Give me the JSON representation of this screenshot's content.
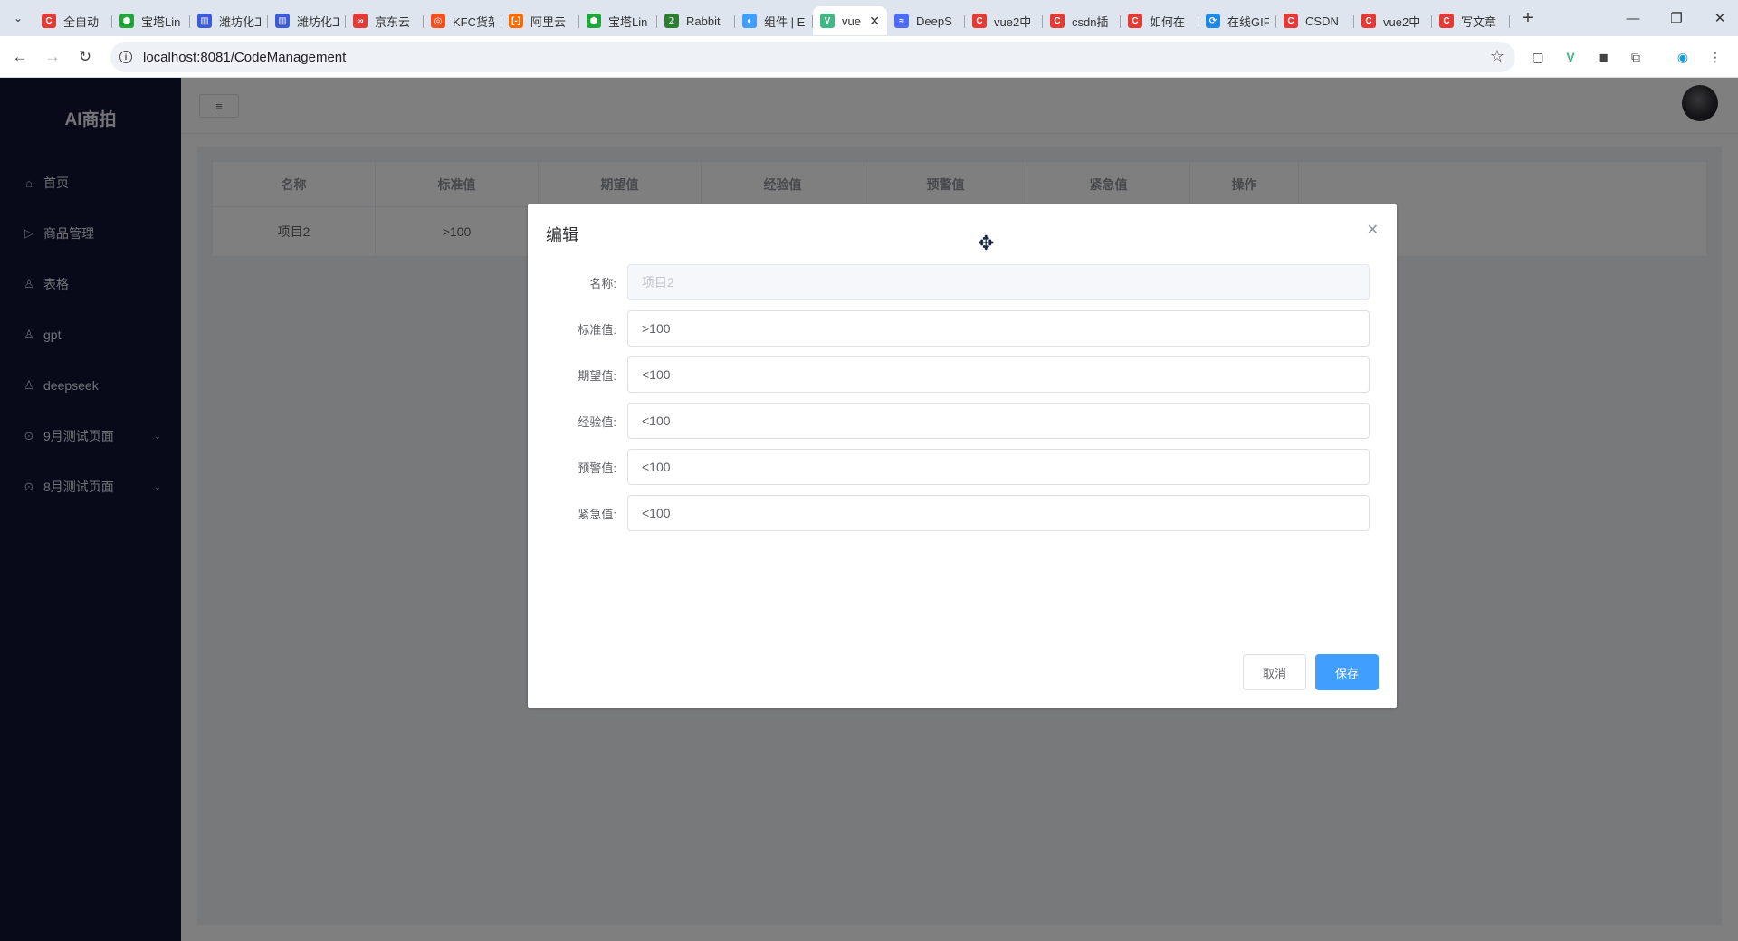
{
  "browser": {
    "tabs": [
      {
        "title": "全自动",
        "favicon_color": "#e53935",
        "glyph": "C"
      },
      {
        "title": "宝塔Lin",
        "favicon_color": "#20a53a",
        "glyph": "⬢"
      },
      {
        "title": "潍坊化工",
        "favicon_color": "#3b5bdb",
        "glyph": "▥"
      },
      {
        "title": "潍坊化工",
        "favicon_color": "#3b5bdb",
        "glyph": "▥"
      },
      {
        "title": "京东云",
        "favicon_color": "#e53935",
        "glyph": "∞"
      },
      {
        "title": "KFC货架",
        "favicon_color": "#f4511e",
        "glyph": "◎"
      },
      {
        "title": "阿里云",
        "favicon_color": "#ff6a00",
        "glyph": "[-]"
      },
      {
        "title": "宝塔Lin",
        "favicon_color": "#20a53a",
        "glyph": "⬢"
      },
      {
        "title": "Rabbit",
        "favicon_color": "#2e7d32",
        "glyph": "𝟚"
      },
      {
        "title": "组件 | E",
        "favicon_color": "#409eff",
        "glyph": "◐"
      },
      {
        "title": "vue",
        "favicon_color": "#41b883",
        "glyph": "V",
        "active": true
      },
      {
        "title": "DeepS",
        "favicon_color": "#4d6bfe",
        "glyph": "≈"
      },
      {
        "title": "vue2中",
        "favicon_color": "#e53935",
        "glyph": "C"
      },
      {
        "title": "csdn插",
        "favicon_color": "#e53935",
        "glyph": "C"
      },
      {
        "title": "如何在",
        "favicon_color": "#e53935",
        "glyph": "C"
      },
      {
        "title": "在线GIF",
        "favicon_color": "#1e88e5",
        "glyph": "⟳"
      },
      {
        "title": "CSDN",
        "favicon_color": "#e53935",
        "glyph": "C"
      },
      {
        "title": "vue2中",
        "favicon_color": "#e53935",
        "glyph": "C"
      },
      {
        "title": "写文章",
        "favicon_color": "#e53935",
        "glyph": "C"
      }
    ],
    "url": "localhost:8081/CodeManagement"
  },
  "sidebar": {
    "brand": "AI商拍",
    "items": [
      {
        "label": "首页",
        "icon": "home-icon",
        "glyph": "⌂"
      },
      {
        "label": "商品管理",
        "icon": "play-circle-icon",
        "glyph": "▷"
      },
      {
        "label": "表格",
        "icon": "user-icon",
        "glyph": "♙"
      },
      {
        "label": "gpt",
        "icon": "user-icon",
        "glyph": "♙"
      },
      {
        "label": "deepseek",
        "icon": "user-icon",
        "glyph": "♙"
      },
      {
        "label": "9月测试页面",
        "icon": "location-icon",
        "glyph": "⊙",
        "submenu": true
      },
      {
        "label": "8月测试页面",
        "icon": "location-icon",
        "glyph": "⊙",
        "submenu": true
      }
    ]
  },
  "table": {
    "headers": [
      "名称",
      "标准值",
      "期望值",
      "经验值",
      "预警值",
      "紧急值",
      "操作"
    ],
    "rows": [
      [
        "项目2",
        ">100",
        "",
        "",
        "",
        "",
        ""
      ]
    ]
  },
  "dialog": {
    "title": "编辑",
    "fields": [
      {
        "label": "名称:",
        "value": "项目2",
        "disabled": true
      },
      {
        "label": "标准值:",
        "value": ">100"
      },
      {
        "label": "期望值:",
        "value": "<100"
      },
      {
        "label": "经验值:",
        "value": "<100"
      },
      {
        "label": "预警值:",
        "value": "<100"
      },
      {
        "label": "紧急值:",
        "value": "<100"
      }
    ],
    "cancel_label": "取消",
    "save_label": "保存"
  },
  "colors": {
    "sidebar_bg": "#111535",
    "primary": "#409eff"
  }
}
